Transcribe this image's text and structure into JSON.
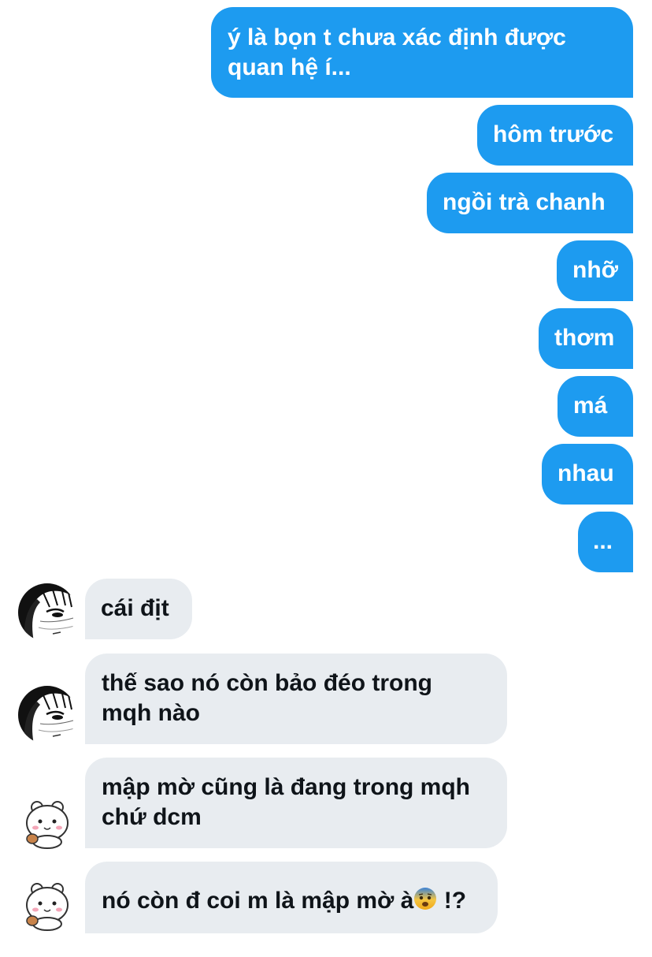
{
  "messages": {
    "out": [
      {
        "line1": "ý là bọn t chưa xác định được",
        "line2": "quan hệ í..."
      },
      {
        "text": "hôm trước"
      },
      {
        "text": "ngồi trà chanh"
      },
      {
        "text": "nhỡ"
      },
      {
        "text": "thơm"
      },
      {
        "text": "má"
      },
      {
        "text": "nhau"
      },
      {
        "text": "..."
      }
    ],
    "in": [
      {
        "text": "cái địt",
        "avatar": "manga-face-avatar"
      },
      {
        "line1": "thế sao nó còn bảo đéo trong",
        "line2": "mqh nào",
        "avatar": "manga-face-avatar"
      },
      {
        "line1": "mập mờ cũng là đang trong mqh",
        "line2": "chứ dcm",
        "avatar": "white-bear-avatar"
      },
      {
        "text_before": "nó còn đ coi m là mập mờ à",
        "emoji": "fearful-face-emoji",
        "text_after": " !?",
        "avatar": "white-bear-avatar"
      }
    ]
  },
  "colors": {
    "outgoing_bubble": "#1d9bf0",
    "outgoing_text": "#ffffff",
    "incoming_bubble": "#e8ecf0",
    "incoming_text": "#0f1419"
  }
}
